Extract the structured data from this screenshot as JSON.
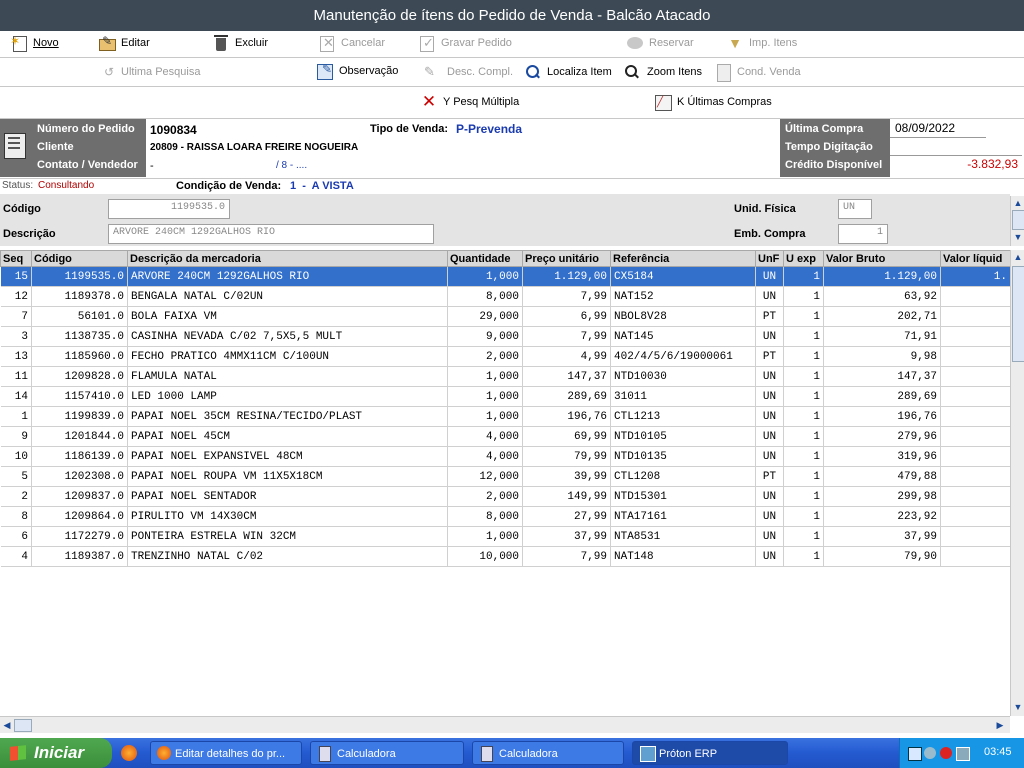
{
  "window": {
    "title": "Manutenção de ítens do Pedido de Venda - Balcão Atacado"
  },
  "toolbar": {
    "novo": "Novo",
    "editar": "Editar",
    "excluir": "Excluir",
    "cancelar": "Cancelar",
    "gravar": "Gravar Pedido",
    "reservar": "Reservar",
    "imp_itens": "Imp. Itens",
    "ultima_pesquisa": "Ultima Pesquisa",
    "observacao": "Observação",
    "desc_compl": "Desc. Compl.",
    "localiza_item": "Localiza Item",
    "zoom_itens": "Zoom Itens",
    "cond_venda": "Cond. Venda",
    "pesq_multipla": "Y Pesq Múltipla",
    "ultimas_compras": "K Últimas Compras"
  },
  "header": {
    "numero_label": "Número do Pedido",
    "numero_value": "1090834",
    "cliente_label": "Cliente",
    "cliente_value": "20809 - RAISSA LOARA FREIRE NOGUEIRA",
    "contato_label": "Contato / Vendedor",
    "contato_value": "-",
    "vendedor_value": "/ 8 - ....",
    "tipo_venda_label": "Tipo de Venda:",
    "tipo_venda_value": "P-Prevenda",
    "ultima_compra_label": "Última Compra",
    "ultima_compra_value": "08/09/2022",
    "tempo_label": "Tempo Digitação",
    "tempo_value": "",
    "credito_label": "Crédito Disponível",
    "credito_value": "-3.832,93",
    "status_label": "Status:",
    "status_value": "Consultando",
    "condicao_label": "Condição de Venda:",
    "condicao_value": "1  -  A VISTA"
  },
  "item_form": {
    "codigo_label": "Código",
    "codigo_value": "1199535.0",
    "descricao_label": "Descrição",
    "descricao_value": "ARVORE 240CM 1292GALHOS RIO",
    "unid_label": "Unid. Física",
    "unid_value": "UN",
    "emb_label": "Emb. Compra",
    "emb_value": "1"
  },
  "grid": {
    "columns": [
      "Seq",
      "Código",
      "Descrição da mercadoria",
      "Quantidade",
      "Preço unitário",
      "Referência",
      "UnF",
      "U exp",
      "Valor Bruto",
      "Valor líquid"
    ],
    "rows": [
      [
        "15",
        "1199535.0",
        "ARVORE 240CM 1292GALHOS RIO",
        "1,000",
        "1.129,00",
        "CX5184",
        "UN",
        "1",
        "1.129,00",
        "1."
      ],
      [
        "12",
        "1189378.0",
        "BENGALA NATAL C/02UN",
        "8,000",
        "7,99",
        "NAT152",
        "UN",
        "1",
        "63,92",
        ""
      ],
      [
        "7",
        "56101.0",
        "BOLA FAIXA VM",
        "29,000",
        "6,99",
        "NBOL8V28",
        "PT",
        "1",
        "202,71",
        ""
      ],
      [
        "3",
        "1138735.0",
        "CASINHA NEVADA C/02 7,5X5,5 MULT",
        "9,000",
        "7,99",
        "NAT145",
        "UN",
        "1",
        "71,91",
        ""
      ],
      [
        "13",
        "1185960.0",
        "FECHO PRATICO 4MMX11CM C/100UN",
        "2,000",
        "4,99",
        "402/4/5/6/19000061",
        "PT",
        "1",
        "9,98",
        ""
      ],
      [
        "11",
        "1209828.0",
        "FLAMULA NATAL",
        "1,000",
        "147,37",
        "NTD10030",
        "UN",
        "1",
        "147,37",
        ""
      ],
      [
        "14",
        "1157410.0",
        "LED 1000 LAMP",
        "1,000",
        "289,69",
        "31011",
        "UN",
        "1",
        "289,69",
        ""
      ],
      [
        "1",
        "1199839.0",
        "PAPAI NOEL 35CM RESINA/TECIDO/PLAST",
        "1,000",
        "196,76",
        "CTL1213",
        "UN",
        "1",
        "196,76",
        ""
      ],
      [
        "9",
        "1201844.0",
        "PAPAI NOEL 45CM",
        "4,000",
        "69,99",
        "NTD10105",
        "UN",
        "1",
        "279,96",
        ""
      ],
      [
        "10",
        "1186139.0",
        "PAPAI NOEL EXPANSIVEL 48CM",
        "4,000",
        "79,99",
        "NTD10135",
        "UN",
        "1",
        "319,96",
        ""
      ],
      [
        "5",
        "1202308.0",
        "PAPAI NOEL ROUPA VM 11X5X18CM",
        "12,000",
        "39,99",
        "CTL1208",
        "PT",
        "1",
        "479,88",
        ""
      ],
      [
        "2",
        "1209837.0",
        "PAPAI NOEL SENTADOR",
        "2,000",
        "149,99",
        "NTD15301",
        "UN",
        "1",
        "299,98",
        ""
      ],
      [
        "8",
        "1209864.0",
        "PIRULITO VM 14X30CM",
        "8,000",
        "27,99",
        "NTA17161",
        "UN",
        "1",
        "223,92",
        ""
      ],
      [
        "6",
        "1172279.0",
        "PONTEIRA ESTRELA WIN 32CM",
        "1,000",
        "37,99",
        "NTA8531",
        "UN",
        "1",
        "37,99",
        ""
      ],
      [
        "4",
        "1189387.0",
        "TRENZINHO NATAL C/02",
        "10,000",
        "7,99",
        "NAT148",
        "UN",
        "1",
        "79,90",
        ""
      ]
    ]
  },
  "taskbar": {
    "start": "Iniciar",
    "tasks": [
      "Editar detalhes do pr...",
      "Calculadora",
      "Calculadora",
      "Próton ERP"
    ],
    "clock": "03:45"
  },
  "colors": {
    "title_bg": "#3d4a55",
    "selection": "#3370cc",
    "negative": "#cc0000",
    "link_blue": "#1a3ab0",
    "taskbar": "#245ad0"
  }
}
